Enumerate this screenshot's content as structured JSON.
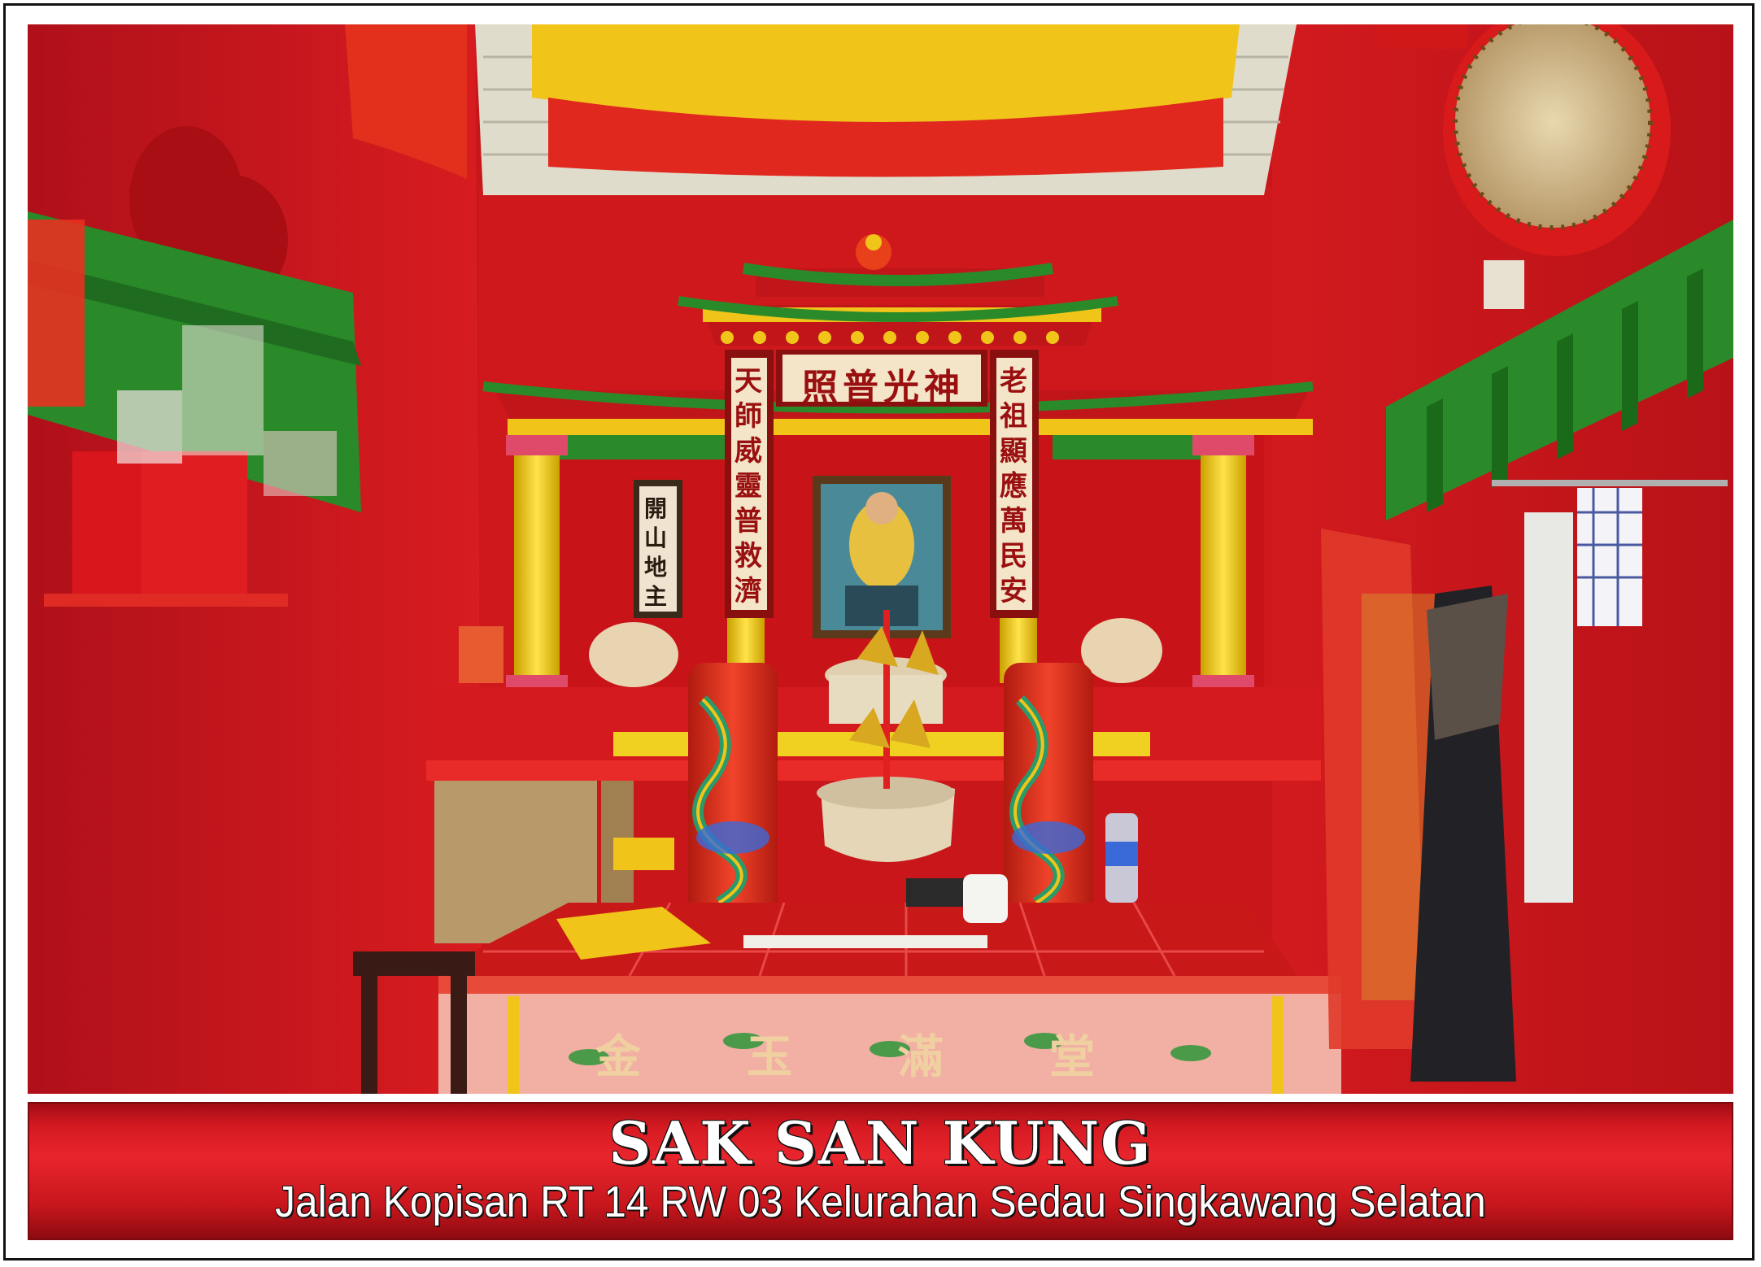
{
  "banner": {
    "title": "SAK SAN KUNG",
    "subtitle": "Jalan Kopisan RT 14 RW 03 Kelurahan Sedau Singkawang Selatan"
  },
  "shrine": {
    "top_plaque": "照普光神",
    "left_couplet": "天師威靈普救濟",
    "right_couplet": "老祖顯應萬民安",
    "small_plaque": "開山地主",
    "cloth_text": "金玉滿堂"
  },
  "colors": {
    "wall_red": "#c8161a",
    "banner_red": "#e8252c",
    "gold": "#f0c419",
    "green": "#2a8a2a"
  }
}
